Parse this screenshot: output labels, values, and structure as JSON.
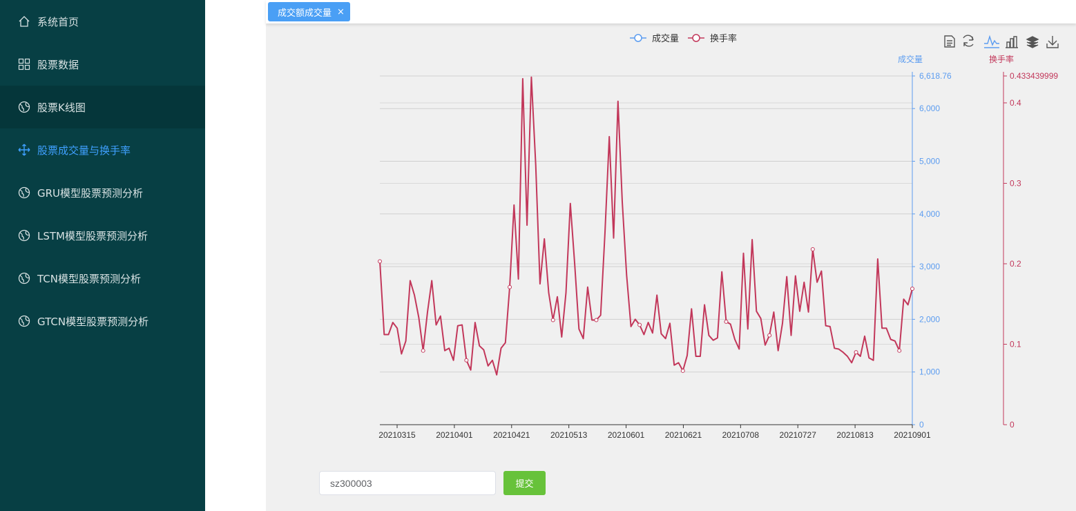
{
  "sidebar": {
    "items": [
      {
        "label": "系统首页",
        "icon": "home-icon"
      },
      {
        "label": "股票数据",
        "icon": "grid-icon"
      },
      {
        "label": "股票K线图",
        "icon": "globe-icon"
      },
      {
        "label": "股票成交量与换手率",
        "icon": "move-icon",
        "active": true
      },
      {
        "label": "GRU模型股票预测分析",
        "icon": "globe-icon"
      },
      {
        "label": "LSTM模型股票预测分析",
        "icon": "globe-icon"
      },
      {
        "label": "TCN模型股票预测分析",
        "icon": "globe-icon"
      },
      {
        "label": "GTCN模型股票预测分析",
        "icon": "globe-icon"
      }
    ]
  },
  "tabs": [
    {
      "label": "成交额成交量",
      "close": "×"
    }
  ],
  "colors": {
    "sidebar_bg": "#073f44",
    "active": "#3fa0ff",
    "volume": "#5b9cf0",
    "turnover": "#c2375a",
    "submit": "#67c23a",
    "tab": "#4a9ff5"
  },
  "form": {
    "code_value": "sz300003",
    "submit_label": "提交"
  },
  "chart_data": {
    "type": "line",
    "legend": [
      "成交量",
      "换手率"
    ],
    "legend_position": "top-center",
    "toolbox": [
      "data-view-icon",
      "refresh-icon",
      "line-chart-icon",
      "bar-chart-icon",
      "stack-icon",
      "download-icon"
    ],
    "y_axes": [
      {
        "name": "成交量",
        "min": 0,
        "max": 6618.76,
        "max_label": "6,618.76",
        "ticks": [
          "0",
          "1,000",
          "2,000",
          "3,000",
          "4,000",
          "5,000",
          "6,000"
        ]
      },
      {
        "name": "换手率",
        "min": 0,
        "max": 0.433439999,
        "max_label": "0.433439999",
        "ticks": [
          "0",
          "0.1",
          "0.2",
          "0.3",
          "0.4"
        ]
      }
    ],
    "x_tick_labels": [
      "20210315",
      "20210401",
      "20210421",
      "20210513",
      "20210601",
      "20210621",
      "20210708",
      "20210727",
      "20210813",
      "20210901"
    ],
    "x_count": 120,
    "series": [
      {
        "name": "换手率",
        "values": [
          0.203,
          0.112,
          0.112,
          0.127,
          0.12,
          0.088,
          0.104,
          0.179,
          0.161,
          0.133,
          0.092,
          0.14,
          0.179,
          0.124,
          0.135,
          0.092,
          0.095,
          0.08,
          0.123,
          0.124,
          0.08,
          0.068,
          0.127,
          0.098,
          0.093,
          0.073,
          0.08,
          0.062,
          0.095,
          0.102,
          0.171,
          0.273,
          0.181,
          0.43,
          0.248,
          0.432,
          0.323,
          0.175,
          0.231,
          0.164,
          0.13,
          0.159,
          0.109,
          0.164,
          0.275,
          0.2,
          0.119,
          0.107,
          0.171,
          0.13,
          0.13,
          0.136,
          0.239,
          0.358,
          0.232,
          0.402,
          0.277,
          0.186,
          0.122,
          0.131,
          0.124,
          0.112,
          0.127,
          0.114,
          0.161,
          0.113,
          0.107,
          0.126,
          0.074,
          0.077,
          0.067,
          0.086,
          0.144,
          0.085,
          0.085,
          0.149,
          0.111,
          0.105,
          0.108,
          0.19,
          0.128,
          0.125,
          0.106,
          0.094,
          0.213,
          0.119,
          0.23,
          0.141,
          0.132,
          0.099,
          0.111,
          0.14,
          0.092,
          0.126,
          0.184,
          0.111,
          0.185,
          0.141,
          0.177,
          0.14,
          0.218,
          0.177,
          0.191,
          0.123,
          0.122,
          0.095,
          0.094,
          0.09,
          0.085,
          0.077,
          0.09,
          0.085,
          0.11,
          0.083,
          0.08,
          0.206,
          0.12,
          0.12,
          0.106,
          0.104,
          0.092,
          0.156,
          0.149,
          0.169
        ]
      }
    ]
  }
}
